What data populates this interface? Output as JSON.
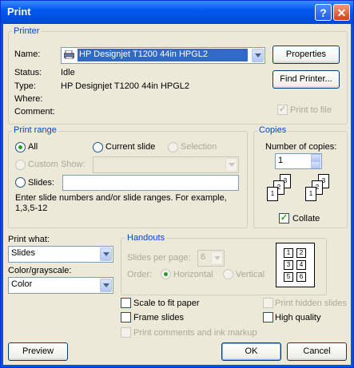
{
  "title": "Print",
  "title_help": "?",
  "title_close": "✕",
  "printer": {
    "group_label": "Printer",
    "name_label": "Name:",
    "name_value": "HP Designjet T1200 44in HPGL2",
    "status_label": "Status:",
    "status_value": "Idle",
    "type_label": "Type:",
    "type_value": "HP Designjet T1200 44in HPGL2",
    "where_label": "Where:",
    "comment_label": "Comment:",
    "properties_button": "Properties",
    "find_printer_button": "Find Printer...",
    "print_to_file": "Print to file",
    "print_to_file_checked": true
  },
  "print_range": {
    "group_label": "Print range",
    "all": "All",
    "current_slide": "Current slide",
    "selection": "Selection",
    "custom_show": "Custom Show:",
    "slides": "Slides:",
    "hint": "Enter slide numbers and/or slide ranges. For example, 1,3,5-12",
    "selected": "all"
  },
  "copies": {
    "group_label": "Copies",
    "number_label": "Number of copies:",
    "number_value": "1",
    "collate": "Collate",
    "collate_checked": true,
    "page_numbers": [
      "1",
      "2",
      "3"
    ]
  },
  "print_what": {
    "label": "Print what:",
    "value": "Slides"
  },
  "color": {
    "label": "Color/grayscale:",
    "value": "Color"
  },
  "handouts": {
    "group_label": "Handouts",
    "slides_per_page_label": "Slides per page:",
    "slides_per_page_value": "6",
    "order_label": "Order:",
    "horizontal": "Horizontal",
    "vertical": "Vertical",
    "preview_cells": [
      "1",
      "2",
      "3",
      "4",
      "5",
      "6"
    ]
  },
  "options": {
    "scale_to_fit": "Scale to fit paper",
    "frame_slides": "Frame slides",
    "print_comments": "Print comments and ink markup",
    "print_hidden": "Print hidden slides",
    "high_quality": "High quality"
  },
  "buttons": {
    "preview": "Preview",
    "ok": "OK",
    "cancel": "Cancel"
  }
}
